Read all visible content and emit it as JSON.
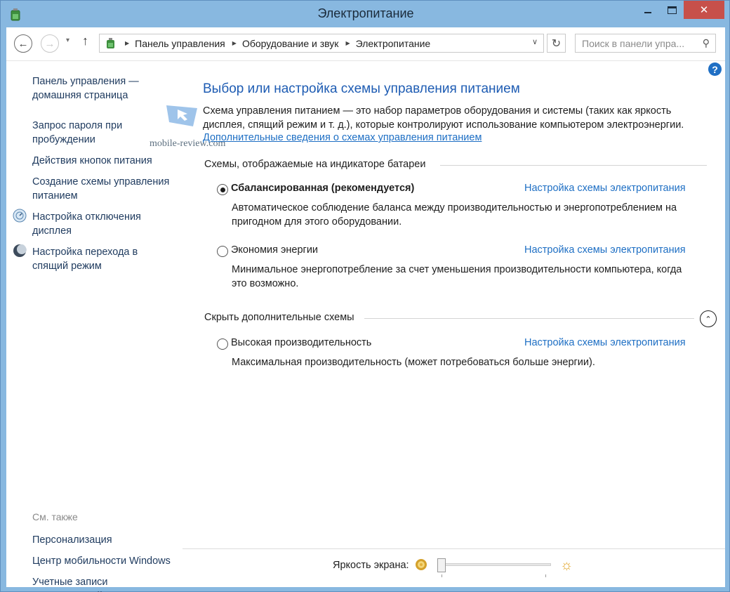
{
  "window": {
    "title": "Электропитание",
    "close_symbol": "✕"
  },
  "nav": {
    "back_symbol": "←",
    "forward_symbol": "→",
    "recent_symbol": "▾",
    "up_symbol": "↑",
    "breadcrumbs": [
      "Панель управления",
      "Оборудование и звук",
      "Электропитание"
    ],
    "refresh_symbol": "↻",
    "search_placeholder": "Поиск в панели упра...",
    "search_symbol": "⚲"
  },
  "help_label": "?",
  "sidebar": {
    "links": [
      {
        "label": "Панель управления — домашняя страница"
      },
      {
        "label": "Запрос пароля при пробуждении"
      },
      {
        "label": "Действия кнопок питания"
      },
      {
        "label": "Создание схемы управления питанием"
      },
      {
        "label": "Настройка отключения дисплея",
        "icon": "display-icon"
      },
      {
        "label": "Настройка перехода в спящий режим",
        "icon": "moon-icon"
      }
    ],
    "see_also_label": "См. также",
    "see_also": [
      {
        "label": "Персонализация"
      },
      {
        "label": "Центр мобильности Windows"
      },
      {
        "label": "Учетные записи пользователей"
      }
    ]
  },
  "watermark": {
    "text": "mobile-review.com"
  },
  "main": {
    "heading": "Выбор или настройка схемы управления питанием",
    "description": "Схема управления питанием — это набор параметров оборудования и системы (таких как яркость дисплея, спящий режим и т. д.), которые контролируют использование компьютером электроэнергии.",
    "more_link": "Дополнительные сведения о схемах управления питанием",
    "group_battery": "Схемы, отображаемые на индикаторе батареи",
    "group_hidden": "Скрыть дополнительные схемы",
    "collapse_symbol": "⌃",
    "plans": [
      {
        "name": "Сбалансированная (рекомендуется)",
        "selected": true,
        "link": "Настройка схемы электропитания",
        "description": "Автоматическое соблюдение баланса между производительностью и энергопотреблением на пригодном для этого оборудовании."
      },
      {
        "name": "Экономия энергии",
        "selected": false,
        "link": "Настройка схемы электропитания",
        "description": "Минимальное энергопотребление за счет уменьшения производительности компьютера, когда это возможно."
      },
      {
        "name": "Высокая производительность",
        "selected": false,
        "link": "Настройка схемы электропитания",
        "description": "Максимальная производительность (может потребоваться больше энергии)."
      }
    ]
  },
  "brightness": {
    "label": "Яркость экрана:",
    "value_fraction": 0.0,
    "big_sun_symbol": "☼"
  },
  "colors": {
    "accent": "#1e6fc4",
    "heading": "#1e5cb3",
    "close": "#c7504a",
    "frame": "#88b8e0"
  }
}
